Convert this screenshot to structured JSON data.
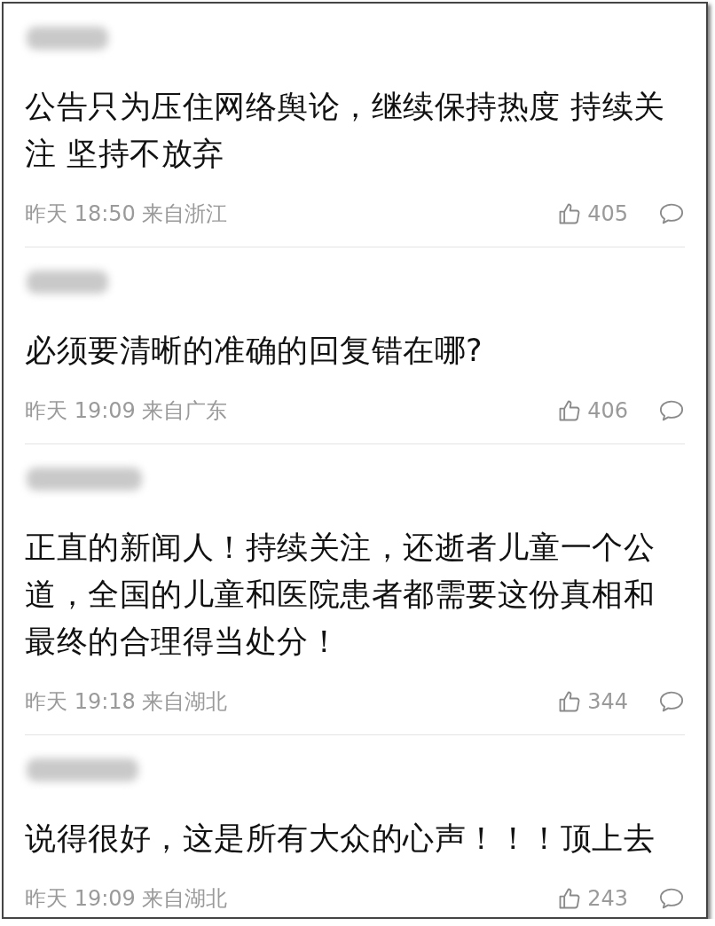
{
  "comments": [
    {
      "text": "公告只为压住网络舆论，继续保持热度 持续关注 坚持不放弃",
      "time": "昨天 18:50",
      "location": "来自浙江",
      "likes": "405"
    },
    {
      "text": "必须要清晰的准确的回复错在哪?",
      "time": "昨天 19:09",
      "location": "来自广东",
      "likes": "406"
    },
    {
      "text": "正直的新闻人！持续关注，还逝者儿童一个公道，全国的儿童和医院患者都需要这份真相和最终的合理得当处分！",
      "time": "昨天 19:18",
      "location": "来自湖北",
      "likes": "344"
    },
    {
      "text": "说得很好，这是所有大众的心声！！！顶上去",
      "time": "昨天 19:09",
      "location": "来自湖北",
      "likes": "243"
    }
  ]
}
